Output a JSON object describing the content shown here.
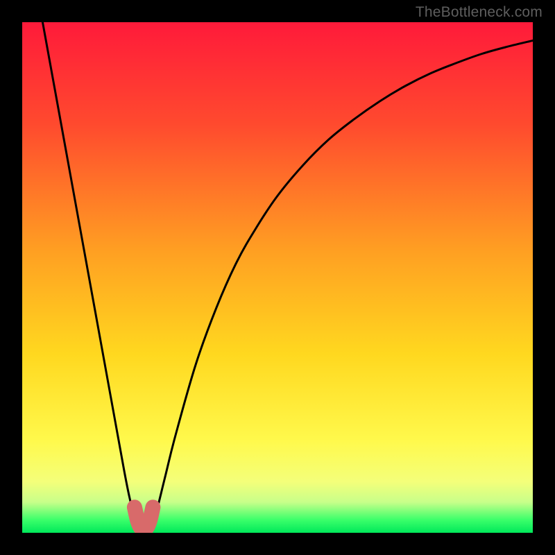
{
  "watermark": "TheBottleneck.com",
  "chart_data": {
    "type": "line",
    "title": "",
    "xlabel": "",
    "ylabel": "",
    "xlim": [
      0,
      100
    ],
    "ylim": [
      0,
      100
    ],
    "gradient_stops": [
      {
        "offset": 0.0,
        "color": "#ff1a3a"
      },
      {
        "offset": 0.2,
        "color": "#ff4a2e"
      },
      {
        "offset": 0.45,
        "color": "#ffa022"
      },
      {
        "offset": 0.65,
        "color": "#ffd81f"
      },
      {
        "offset": 0.82,
        "color": "#fff94c"
      },
      {
        "offset": 0.9,
        "color": "#f4ff7a"
      },
      {
        "offset": 0.94,
        "color": "#c8ff8a"
      },
      {
        "offset": 0.975,
        "color": "#3aff6a"
      },
      {
        "offset": 1.0,
        "color": "#00e85a"
      }
    ],
    "series": [
      {
        "name": "bottleneck-curve",
        "x": [
          4,
          6,
          8,
          10,
          12,
          14,
          16,
          18,
          20,
          21,
          22,
          22.8,
          23.6,
          24.4,
          25.2,
          26,
          28,
          30,
          34,
          38,
          42,
          46,
          50,
          55,
          60,
          65,
          70,
          75,
          80,
          85,
          90,
          95,
          100
        ],
        "y": [
          100,
          89,
          78,
          67,
          56,
          45,
          34,
          23,
          12,
          7,
          3,
          1,
          0.4,
          0.4,
          1,
          3,
          11,
          19,
          33,
          44,
          53,
          60,
          66,
          72,
          77,
          81,
          84.5,
          87.5,
          90,
          92,
          93.8,
          95.2,
          96.4
        ]
      }
    ],
    "highlight_segment": {
      "name": "optimal-notch",
      "color": "#d86a6a",
      "x": [
        22.0,
        22.6,
        23.2,
        23.8,
        24.4,
        25.0,
        25.6
      ],
      "y": [
        5.0,
        2.4,
        1.0,
        0.6,
        1.0,
        2.4,
        5.0
      ]
    }
  }
}
